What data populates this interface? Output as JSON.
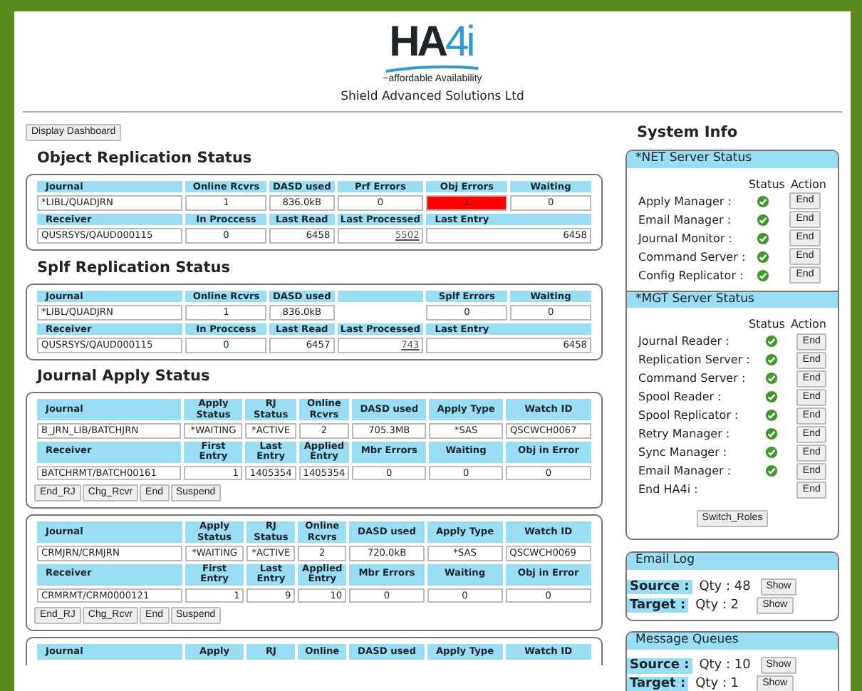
{
  "header": {
    "logo": {
      "main": "HA",
      "accent": "4i"
    },
    "tagline": "~affordable Availability",
    "company": "Shield Advanced Solutions Ltd"
  },
  "dashboard_button": "Display Dashboard",
  "replication": [
    {
      "title": "Object Replication Status",
      "columns": [
        {
          "text": "Journal"
        },
        {
          "text": "Online Rcvrs"
        },
        {
          "text": "DASD used"
        },
        {
          "text": "Prf Errors"
        },
        {
          "text": "Obj Errors"
        },
        {
          "text": "Waiting"
        }
      ],
      "row": [
        {
          "text": "*LIBL/QUADJRN",
          "kind": "name"
        },
        {
          "text": "1",
          "kind": "value"
        },
        {
          "text": "836.0kB",
          "kind": "value"
        },
        {
          "text": "0",
          "kind": "value"
        },
        {
          "text": "1",
          "kind": "alert"
        },
        {
          "text": "0",
          "kind": "value"
        }
      ],
      "receiver_columns": [
        {
          "text": "Receiver"
        },
        {
          "text": "In Proccess"
        },
        {
          "text": "Last Read"
        },
        {
          "text": "Last Processed"
        },
        {
          "text": "Last Entry"
        }
      ],
      "receiver_row": [
        {
          "text": "QUSRSYS/QAUD000115",
          "kind": "name"
        },
        {
          "text": "0",
          "kind": "value"
        },
        {
          "text": "6458",
          "kind": "count"
        },
        {
          "text": "5502",
          "kind": "link"
        },
        {
          "text": "6458",
          "kind": "count"
        }
      ]
    },
    {
      "title": "Splf Replication Status",
      "columns": [
        {
          "text": "Journal"
        },
        {
          "text": "Online Rcvrs"
        },
        {
          "text": "DASD used"
        },
        {
          "kind": "blank"
        },
        {
          "text": "Splf Errors"
        },
        {
          "text": "Waiting"
        }
      ],
      "row": [
        {
          "text": "*LIBL/QUADJRN",
          "kind": "name"
        },
        {
          "text": "1",
          "kind": "value"
        },
        {
          "text": "836.0kB",
          "kind": "value"
        },
        {
          "kind": "blank"
        },
        {
          "text": "0",
          "kind": "value"
        },
        {
          "text": "0",
          "kind": "value"
        }
      ],
      "receiver_columns": [
        {
          "text": "Receiver"
        },
        {
          "text": "In Proccess"
        },
        {
          "text": "Last Read"
        },
        {
          "text": "Last Processed"
        },
        {
          "text": "Last Entry"
        }
      ],
      "receiver_row": [
        {
          "text": "QUSRSYS/QAUD000115",
          "kind": "name"
        },
        {
          "text": "0",
          "kind": "value"
        },
        {
          "text": "6457",
          "kind": "count"
        },
        {
          "text": "743",
          "kind": "link"
        },
        {
          "text": "6458",
          "kind": "count"
        }
      ]
    }
  ],
  "journal_apply": {
    "title": "Journal Apply Status",
    "entries": [
      {
        "columns": [
          "Journal",
          "Apply Status",
          "RJ Status",
          "Online Rcvrs",
          "DASD used",
          "Apply Type",
          "Watch ID"
        ],
        "row": [
          {
            "text": "B_JRN_LIB/BATCHJRN",
            "kind": "name"
          },
          {
            "text": "*WAITING",
            "kind": "value"
          },
          {
            "text": "*ACTIVE",
            "kind": "value"
          },
          {
            "text": "2",
            "kind": "value"
          },
          {
            "text": "705.3MB",
            "kind": "value"
          },
          {
            "text": "*SAS",
            "kind": "value"
          },
          {
            "text": "QSCWCH0067",
            "kind": "name"
          }
        ],
        "receiver_columns": [
          "Receiver",
          "First Entry",
          "Last Entry",
          "Applied Entry",
          "Mbr Errors",
          "Waiting",
          "Obj in Error"
        ],
        "receiver_row": [
          {
            "text": "BATCHRMT/BATCH00161",
            "kind": "name"
          },
          {
            "text": "1",
            "kind": "count"
          },
          {
            "text": "1405354",
            "kind": "count"
          },
          {
            "text": "1405354",
            "kind": "value"
          },
          {
            "text": "0",
            "kind": "value"
          },
          {
            "text": "0",
            "kind": "value"
          },
          {
            "text": "0",
            "kind": "value"
          }
        ],
        "buttons": [
          "End_RJ",
          "Chg_Rcvr",
          "End",
          "Suspend"
        ]
      },
      {
        "columns": [
          "Journal",
          "Apply Status",
          "RJ Status",
          "Online Rcvrs",
          "DASD used",
          "Apply Type",
          "Watch ID"
        ],
        "row": [
          {
            "text": "CRMJRN/CRMJRN",
            "kind": "name"
          },
          {
            "text": "*WAITING",
            "kind": "value"
          },
          {
            "text": "*ACTIVE",
            "kind": "value"
          },
          {
            "text": "2",
            "kind": "value"
          },
          {
            "text": "720.0kB",
            "kind": "value"
          },
          {
            "text": "*SAS",
            "kind": "value"
          },
          {
            "text": "QSCWCH0069",
            "kind": "name"
          }
        ],
        "receiver_columns": [
          "Receiver",
          "First Entry",
          "Last Entry",
          "Applied Entry",
          "Mbr Errors",
          "Waiting",
          "Obj in Error"
        ],
        "receiver_row": [
          {
            "text": "CRMRMT/CRM0000121",
            "kind": "name"
          },
          {
            "text": "1",
            "kind": "count"
          },
          {
            "text": "9",
            "kind": "count"
          },
          {
            "text": "10",
            "kind": "count"
          },
          {
            "text": "0",
            "kind": "value"
          },
          {
            "text": "0",
            "kind": "value"
          },
          {
            "text": "0",
            "kind": "value"
          }
        ],
        "buttons": [
          "End_RJ",
          "Chg_Rcvr",
          "End",
          "Suspend"
        ]
      },
      {
        "columns": [
          "Journal",
          "Apply",
          "RJ",
          "Online",
          "DASD used",
          "Apply Type",
          "Watch ID"
        ]
      }
    ]
  },
  "system_info": {
    "title": "System Info",
    "server_groups": [
      {
        "title": "*NET Server Status",
        "status_header": "Status",
        "action_header": "Action",
        "servers": [
          {
            "name": "Apply Manager :",
            "running": true,
            "action": "End"
          },
          {
            "name": "Email Manager :",
            "running": true,
            "action": "End"
          },
          {
            "name": "Journal Monitor :",
            "running": true,
            "action": "End"
          },
          {
            "name": "Command Server :",
            "running": true,
            "action": "End"
          },
          {
            "name": "Config Replicator :",
            "running": true,
            "action": "End"
          }
        ]
      },
      {
        "title": "*MGT Server Status",
        "status_header": "Status",
        "action_header": "Action",
        "servers": [
          {
            "name": "Journal Reader :",
            "running": true,
            "action": "End"
          },
          {
            "name": "Replication Server :",
            "running": true,
            "action": "End"
          },
          {
            "name": "Command Server :",
            "running": true,
            "action": "End"
          },
          {
            "name": "Spool Reader :",
            "running": true,
            "action": "End"
          },
          {
            "name": "Spool Replicator :",
            "running": true,
            "action": "End"
          },
          {
            "name": "Retry Manager :",
            "running": true,
            "action": "End"
          },
          {
            "name": "Sync Manager :",
            "running": true,
            "action": "End"
          },
          {
            "name": "Email Manager :",
            "running": true,
            "action": "End"
          },
          {
            "name": "End HA4i :",
            "running": false,
            "action": "End"
          }
        ],
        "footer_button": "Switch_Roles"
      }
    ],
    "logs": [
      {
        "title": "Email Log",
        "rows": [
          {
            "label": "Source :",
            "qty": "Qty : 48",
            "button": "Show"
          },
          {
            "label": "Target :",
            "qty": "Qty : 2",
            "button": "Show"
          }
        ]
      },
      {
        "title": "Message Queues",
        "rows": [
          {
            "label": "Source :",
            "qty": "Qty : 10",
            "button": "Show"
          },
          {
            "label": "Target :",
            "qty": "Qty : 1",
            "button": "Show"
          }
        ]
      }
    ]
  }
}
